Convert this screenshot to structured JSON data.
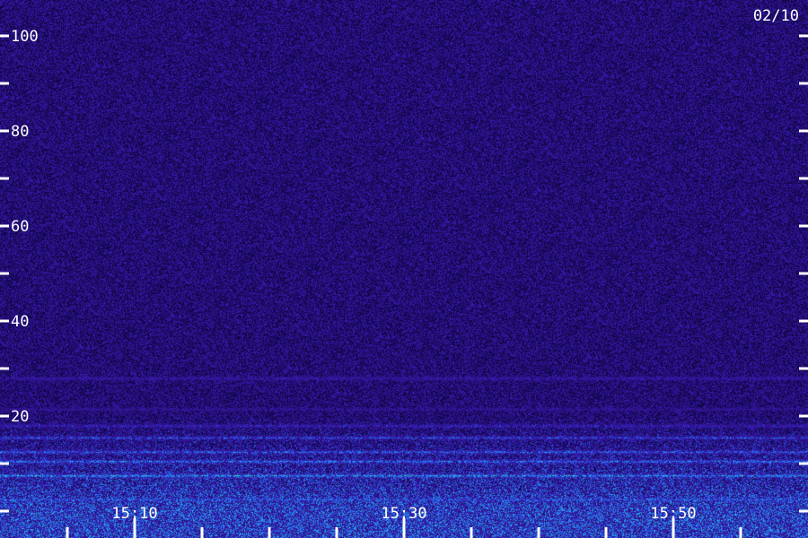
{
  "chart_data": {
    "type": "heatmap",
    "date_label": "02/10",
    "y_ticks": [
      100,
      80,
      60,
      40,
      20
    ],
    "y_minor_ticks": [
      90,
      70,
      50,
      30,
      10
    ],
    "ylim": [
      0,
      102
    ],
    "x_ticks": [
      "15:10",
      "15:30",
      "15:50"
    ],
    "colors": {
      "background": "#2a0a6e",
      "low": "#160640",
      "mid": "#3a1aa8",
      "high": "#2a6aff",
      "peak": "#37ff90",
      "axis": "#ffffff"
    },
    "bands": [
      {
        "y": 28,
        "intensity": 0.55
      },
      {
        "y": 21.5,
        "intensity": 0.45
      },
      {
        "y": 18,
        "intensity": 0.6
      },
      {
        "y": 15.5,
        "intensity": 0.7
      },
      {
        "y": 12.5,
        "intensity": 0.75
      },
      {
        "y": 10.5,
        "intensity": 0.8
      },
      {
        "y": 7.5,
        "intensity": 0.85
      },
      {
        "y": 2.5,
        "intensity": 0.7
      }
    ]
  }
}
